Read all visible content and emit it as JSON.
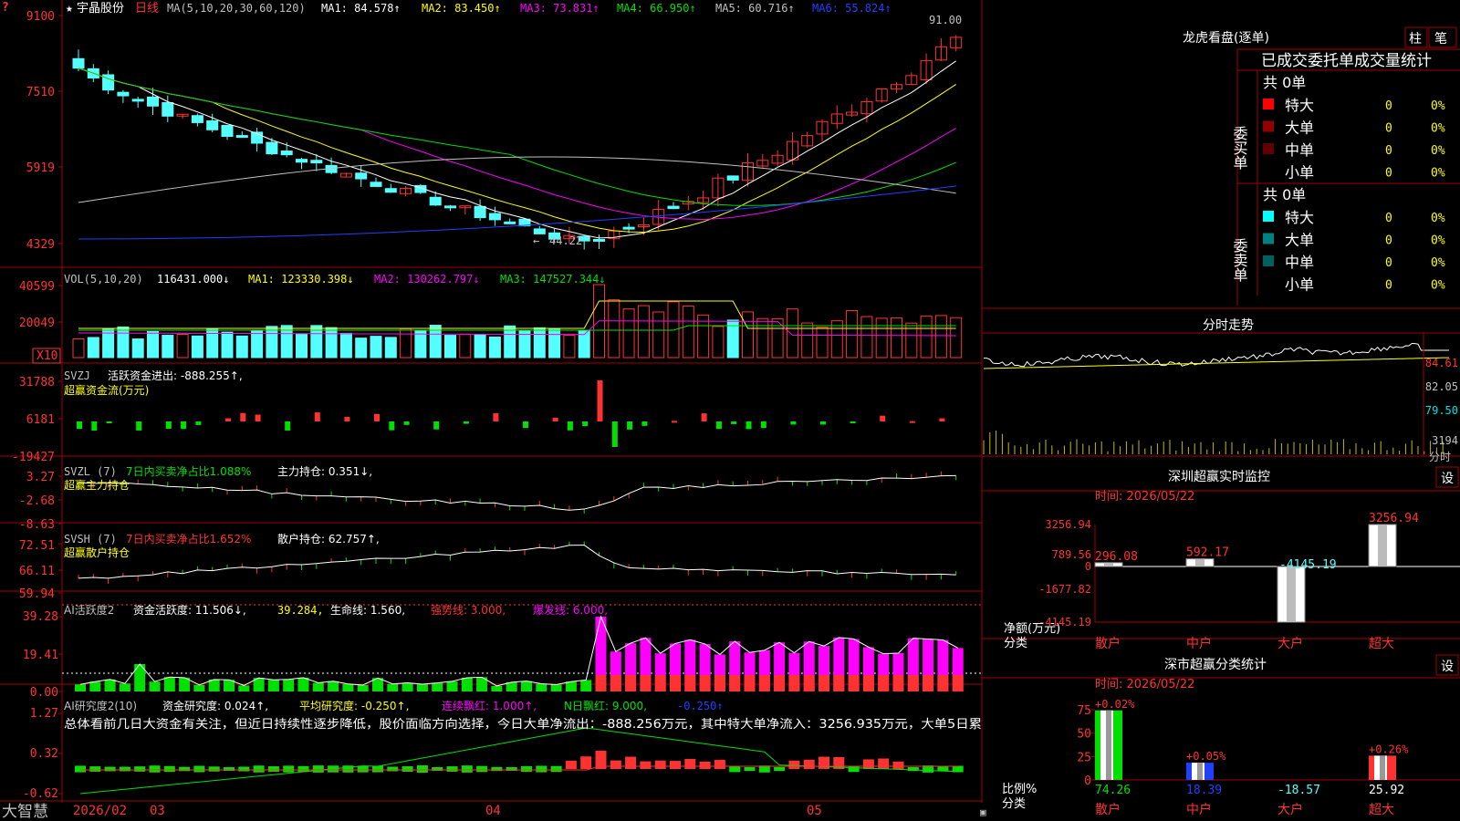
{
  "stock": {
    "name": "宇晶股份",
    "period": "日线"
  },
  "colors": {
    "up": "#ff3232",
    "down": "#54ffff",
    "ma1": "#ffffff",
    "ma2": "#ffff00",
    "ma3": "#ff00ff",
    "ma4": "#00e000",
    "ma5": "#c0c0c0",
    "ma6": "#2040ff",
    "grid": "#a00000",
    "green_bar": "#00e000",
    "magenta_bar": "#ff00ff"
  },
  "price_panel": {
    "ma_prefix": "MA(5,10,20,30,60,120)",
    "ma_labels": [
      "MA1: 84.578↑",
      "MA2: 83.450↑",
      "MA3: 73.831↑",
      "MA4: 66.950↑",
      "MA5: 60.716↑",
      "MA6: 55.824↑"
    ],
    "y_ticks": [
      "9100",
      "7510",
      "5919",
      "4329"
    ],
    "high_note": "91.00",
    "low_note": "44.22"
  },
  "vol_panel": {
    "title": "VOL(5,10,20)",
    "value": "116431.000↓",
    "ma1": "MA1: 123330.398↓",
    "ma2": "MA2: 130262.797↓",
    "ma3": "MA3: 147527.344↓",
    "y_ticks": [
      "40599",
      "20049"
    ],
    "unit": "X10"
  },
  "svzj_panel": {
    "title": "SVZJ",
    "label": "活跃资金进出: -888.255↑,",
    "sub": "超赢资金流(万元)",
    "y_ticks": [
      "31788",
      "6181",
      "-19427"
    ]
  },
  "svzl_panel": {
    "title": "SVZL (7)",
    "label1": "7日内买卖净占比1.088%",
    "label2": "主力持仓: 0.351↓,",
    "sub": "超赢主力持仓",
    "y_ticks": [
      "3.27",
      "-2.68",
      "-8.63"
    ]
  },
  "svsh_panel": {
    "title": "SVSH (7)",
    "label1": "7日内买卖净占比1.652%",
    "label2": "散户持仓: 62.757↑,",
    "sub": "超赢散户持仓",
    "y_ticks": [
      "72.51",
      "66.11",
      "59.94"
    ]
  },
  "ai_act_panel": {
    "title": "AI活跃度2",
    "l1": "资金活跃度: 11.506↓,",
    "l2": "39.284,",
    "l3": "生命线: 1.560,",
    "l4": "强势线: 3.000,",
    "l5": "爆发线: 6.000,",
    "y_ticks": [
      "39.28",
      "19.41",
      "0.00"
    ]
  },
  "ai_res_panel": {
    "title": "AI研究度2(10)",
    "l1": "资金研究度: 0.024↑,",
    "l2": "平均研究度: -0.250↑,",
    "l3": "连续飘红: 1.000↑,",
    "l4": "N日飘红: 9.000,",
    "l5": "-0.250↑",
    "desc": "总体看前几日大资金有关注，但近日持续性逐步降低，股价面临方向选择，今日大单净流出：-888.256万元，其中特大单净流入：3256.935万元，大单5日累",
    "y_ticks": [
      "1.27",
      "0.32",
      "-0.62"
    ]
  },
  "bottom_axis": {
    "brand": "大智慧",
    "labels": [
      "2026/02",
      "03",
      "04",
      "05"
    ]
  },
  "lhb": {
    "title": "龙虎看盘(逐单)",
    "btn_bar": "柱",
    "btn_pen": "笔",
    "tabs": [
      "已成交",
      "委托单",
      "成交量",
      "统计"
    ],
    "buy": {
      "side_label": "委买单",
      "total": "共 0单",
      "rows": [
        {
          "label": "特大",
          "count": "0",
          "pct": "0%",
          "color": "#ff0000"
        },
        {
          "label": "大单",
          "count": "0",
          "pct": "0%",
          "color": "#900000"
        },
        {
          "label": "中单",
          "count": "0",
          "pct": "0%",
          "color": "#600000"
        },
        {
          "label": "小单",
          "count": "0",
          "pct": "0%",
          "color": ""
        }
      ]
    },
    "sell": {
      "side_label": "委卖单",
      "total": "共 0单",
      "rows": [
        {
          "label": "特大",
          "count": "0",
          "pct": "0%",
          "color": "#00ffff"
        },
        {
          "label": "大单",
          "count": "0",
          "pct": "0%",
          "color": "#008080"
        },
        {
          "label": "中单",
          "count": "0",
          "pct": "0%",
          "color": "#006060"
        },
        {
          "label": "小单",
          "count": "0",
          "pct": "0%",
          "color": ""
        }
      ]
    }
  },
  "intraday": {
    "title": "分时走势",
    "y_ticks": [
      "84.61",
      "82.05",
      "79.50",
      "3194"
    ],
    "sub": "分时"
  },
  "sz_monitor": {
    "title": "深圳超赢实时监控",
    "btn": "设",
    "date": "时间: 2026/05/22",
    "y_ticks": [
      "3256.94",
      "789.56",
      "0",
      "-1677.82",
      "-4145.19"
    ],
    "y_label": "净额(万元)",
    "x_label": "分类",
    "categories": [
      "散户",
      "中户",
      "大户",
      "超大"
    ],
    "values": [
      296.08,
      592.17,
      -4145.19,
      3256.94
    ],
    "value_labels": [
      "296.08",
      "592.17",
      "-4145.19",
      "3256.94"
    ]
  },
  "sz_class": {
    "title": "深市超赢分类统计",
    "btn": "设",
    "date": "时间: 2026/05/22",
    "y_ticks": [
      "75",
      "50",
      "25",
      "0"
    ],
    "y_label": "比例%",
    "x_label": "分类",
    "categories": [
      "散户",
      "中户",
      "大户",
      "超大"
    ],
    "values": [
      74.26,
      18.39,
      -18.57,
      25.92
    ],
    "value_labels": [
      "74.26",
      "18.39",
      "-18.57",
      "25.92"
    ],
    "deltas": [
      "+0.02%",
      "+0.05%",
      "",
      "+0.26%"
    ]
  }
}
